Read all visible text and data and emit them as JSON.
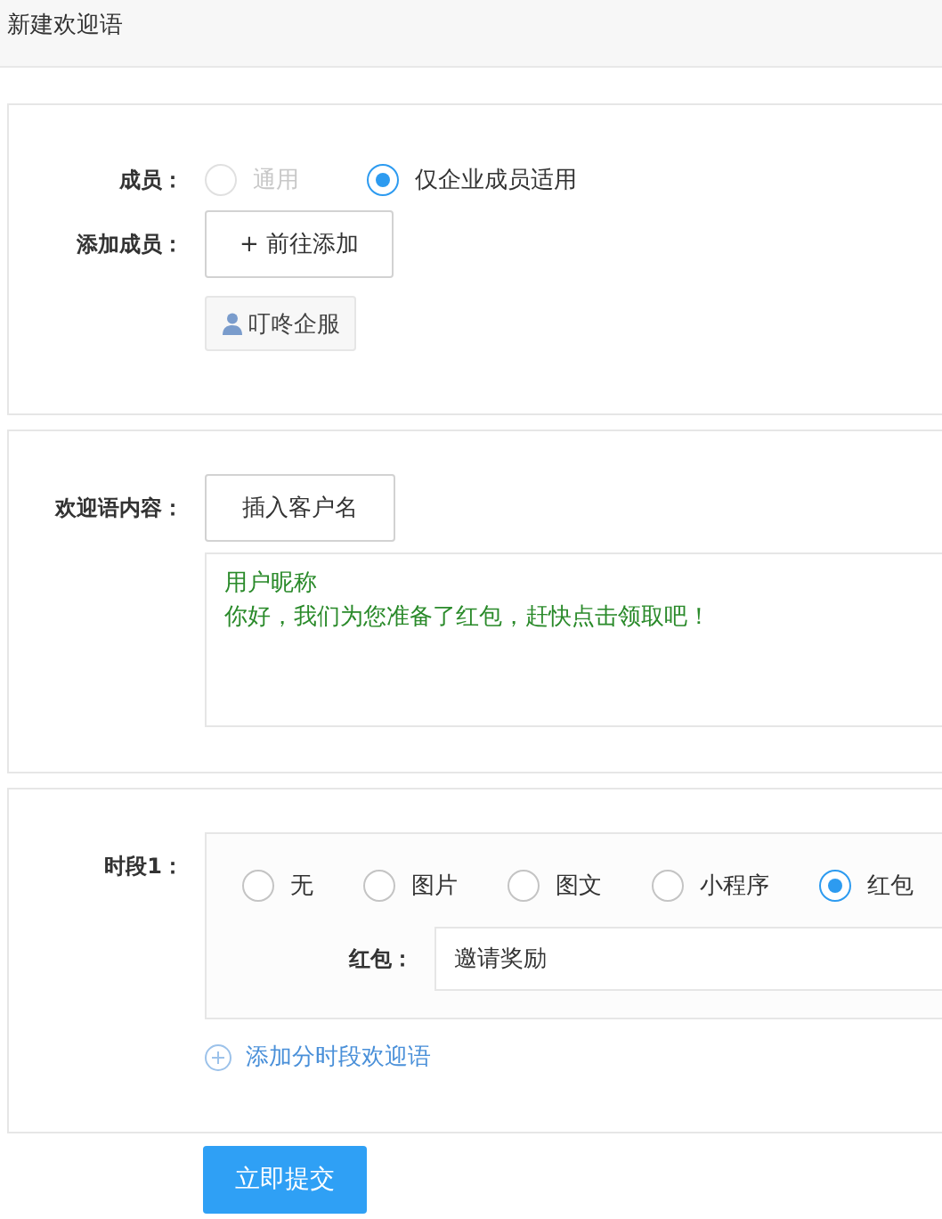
{
  "header": {
    "title": "新建欢迎语"
  },
  "members": {
    "label": "成员：",
    "options": [
      {
        "label": "通用",
        "selected": false,
        "disabled": true
      },
      {
        "label": "仅企业成员适用",
        "selected": true,
        "disabled": false
      }
    ]
  },
  "add_member": {
    "label": "添加成员：",
    "button": "+ 前往添加",
    "tags": [
      "叮咚企服"
    ]
  },
  "content": {
    "label": "欢迎语内容：",
    "insert_button": "插入客户名",
    "lines": [
      "用户昵称",
      "你好，我们为您准备了红包，赶快点击领取吧！"
    ]
  },
  "period": {
    "label": "时段1：",
    "types": [
      {
        "label": "无",
        "selected": false
      },
      {
        "label": "图片",
        "selected": false
      },
      {
        "label": "图文",
        "selected": false
      },
      {
        "label": "小程序",
        "selected": false
      },
      {
        "label": "红包",
        "selected": true
      }
    ],
    "red_packet_label": "红包：",
    "red_packet_value": "邀请奖励",
    "add_link": "添加分时段欢迎语"
  },
  "submit": "立即提交"
}
